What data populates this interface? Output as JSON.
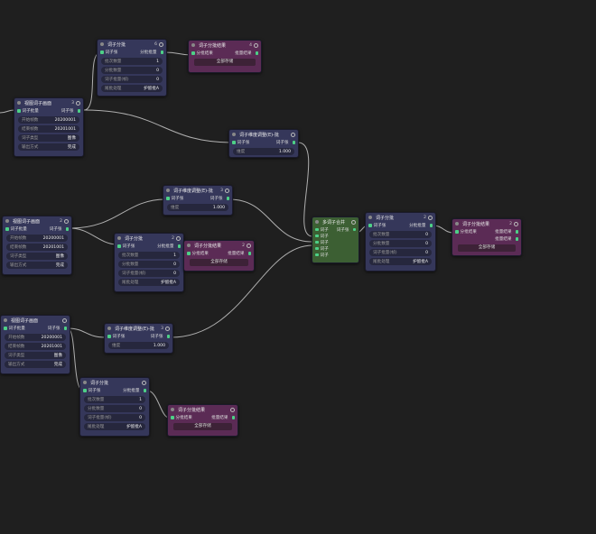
{
  "labels": {
    "split_node": "词子分批",
    "tensor": "词子张",
    "split_out": "分批批量",
    "batch_size": "批次数量",
    "split_count": "分批数量",
    "batch_frame": "词子批量(帧)",
    "frame_short": "词子批量",
    "overlap": "重叠帧",
    "tail_mode": "尾批处理",
    "tail_val": "护留批A",
    "result_node": "词子分批结果",
    "result_in": "分批结果",
    "result_out": "批量结果",
    "execute": "全部存储",
    "view_node": "视图词子画面",
    "start_frame": "开始帧数",
    "end_frame": "结束帧数",
    "tensor_type": "词子类型",
    "type_val": "图像",
    "output_mode": "输出方式",
    "output_val": "完成",
    "transform_node": "词子维度调整(E)-批",
    "dim": "维度",
    "merge_node": "多词子合并",
    "merge_in": "词子"
  },
  "nodes": [
    {
      "id": "split-a",
      "badge": "6",
      "batch": "1",
      "count": "0",
      "frame": "0"
    },
    {
      "id": "result-a",
      "badge": "4"
    },
    {
      "id": "view-a",
      "badge": "3",
      "start": "20200001",
      "end": "20201001"
    },
    {
      "id": "transform-a",
      "badge": "",
      "dim": "1.000"
    },
    {
      "id": "transform-b",
      "badge": "3",
      "dim": "1.000"
    },
    {
      "id": "view-b",
      "badge": "2",
      "start": "20200001",
      "end": "20201001"
    },
    {
      "id": "split-b",
      "badge": "2",
      "batch": "1",
      "count": "0",
      "frame": "0"
    },
    {
      "id": "result-b",
      "badge": "2"
    },
    {
      "id": "merge",
      "badge": ""
    },
    {
      "id": "split-c",
      "badge": "2",
      "batch": "0",
      "count": "0",
      "frame": "0"
    },
    {
      "id": "result-c",
      "badge": "2"
    },
    {
      "id": "view-c",
      "badge": "",
      "start": "20200001",
      "end": "20201001"
    },
    {
      "id": "transform-c",
      "badge": "3",
      "dim": "1.000"
    },
    {
      "id": "split-d",
      "badge": "",
      "batch": "1",
      "count": "0",
      "frame": "0"
    },
    {
      "id": "result-d",
      "badge": ""
    }
  ],
  "colors": {
    "background": "#1f1f1f",
    "node": "#35375a",
    "result": "#5b2b55",
    "merge": "#3c5f33",
    "port": "#4dd087",
    "wire": "#c9c9c9"
  }
}
